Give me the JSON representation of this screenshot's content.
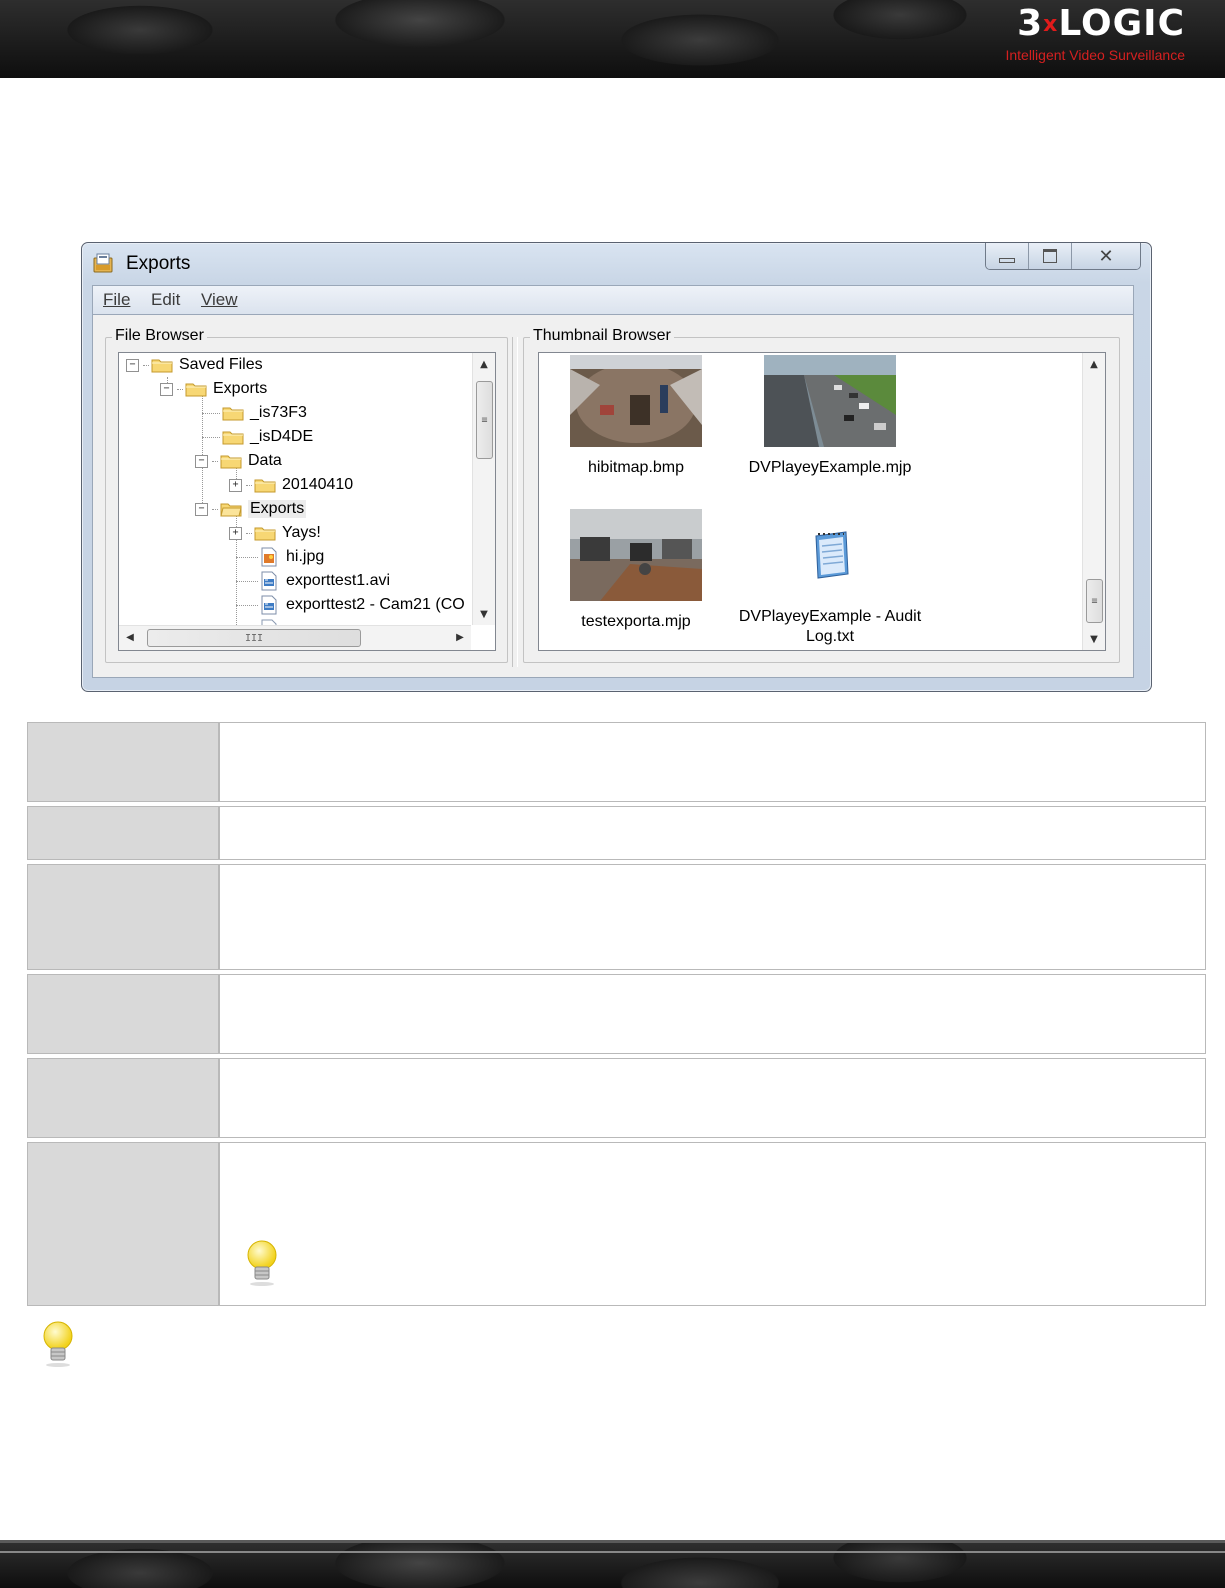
{
  "header": {
    "brand": "3LOGIC",
    "brand_prefix": "3",
    "brand_x": "x",
    "tagline": "Intelligent Video Surveillance"
  },
  "window": {
    "title": "Exports",
    "controls": [
      "minimize-icon",
      "maximize-icon",
      "close-icon"
    ],
    "menu": {
      "file": "File",
      "edit": "Edit",
      "view": "View"
    },
    "file_browser": {
      "label": "File Browser",
      "items": [
        {
          "label": "Saved Files",
          "icon": "folder-icon",
          "expander": "−"
        },
        {
          "label": "Exports",
          "icon": "folder-icon",
          "expander": "−"
        },
        {
          "label": "_is73F3",
          "icon": "folder-icon"
        },
        {
          "label": "_isD4DE",
          "icon": "folder-icon"
        },
        {
          "label": "Data",
          "icon": "folder-icon",
          "expander": "−"
        },
        {
          "label": "20140410",
          "icon": "folder-icon",
          "expander": "+"
        },
        {
          "label": "Exports",
          "icon": "folder-icon",
          "expander": "−",
          "selected": true
        },
        {
          "label": "Yays!",
          "icon": "folder-icon",
          "expander": "+"
        },
        {
          "label": "hi.jpg",
          "icon": "image-file-icon"
        },
        {
          "label": "exporttest1.avi",
          "icon": "video-file-icon"
        },
        {
          "label": "exporttest2 - Cam21 (CO",
          "icon": "video-file-icon"
        }
      ]
    },
    "thumbnail_browser": {
      "label": "Thumbnail Browser",
      "tiles": [
        {
          "caption": "hibitmap.bmp",
          "kind": "camera-overhead"
        },
        {
          "caption": "DVPlayeyExample.mjp",
          "kind": "camera-parking"
        },
        {
          "caption": "testexporta.mjp",
          "kind": "camera-office"
        },
        {
          "caption": "DVPlayeyExample - Audit Log.txt",
          "kind": "notepad-icon"
        }
      ]
    },
    "scroll_grip": "III"
  },
  "table": {
    "rows": [
      {
        "key": "",
        "value": ""
      },
      {
        "key": "",
        "value": ""
      },
      {
        "key": "",
        "value": ""
      },
      {
        "key": "",
        "value": ""
      },
      {
        "key": "",
        "value": ""
      },
      {
        "key": "",
        "value": "",
        "has_tip_icon": true
      }
    ]
  },
  "colors": {
    "header_red": "#d42020",
    "table_key_bg": "#d9d9d9",
    "window_chrome": "#c9d6e6"
  }
}
